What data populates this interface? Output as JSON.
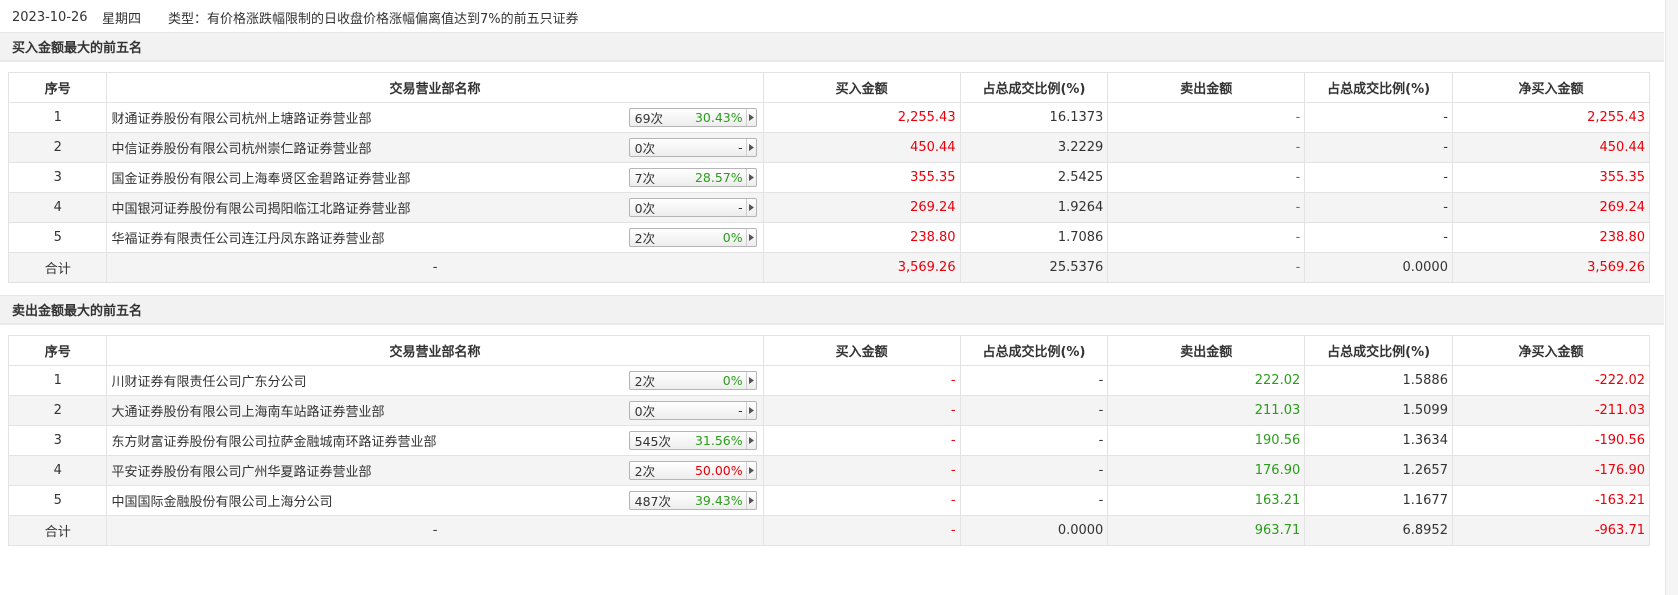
{
  "header": {
    "date": "2023-10-26",
    "weekday": "星期四",
    "type_text": "类型：有价格涨跌幅限制的日收盘价格涨幅偏离值达到7%的前五只证券"
  },
  "columns": [
    "序号",
    "交易营业部名称",
    "买入金额",
    "占总成交比例(%)",
    "卖出金额",
    "占总成交比例(%)",
    "净买入金额"
  ],
  "buy_section": {
    "title": "买入金额最大的前五名",
    "rows": [
      {
        "no": "1",
        "name": "财通证券股份有限公司杭州上塘路证券营业部",
        "count": "69次",
        "rate": "30.43%",
        "rate_color": "green",
        "buy": "2,255.43",
        "buy_pct": "16.1373",
        "sell": "-",
        "sell_pct": "-",
        "net": "2,255.43"
      },
      {
        "no": "2",
        "name": "中信证券股份有限公司杭州崇仁路证券营业部",
        "count": "0次",
        "rate": "-",
        "rate_color": "dash",
        "buy": "450.44",
        "buy_pct": "3.2229",
        "sell": "-",
        "sell_pct": "-",
        "net": "450.44"
      },
      {
        "no": "3",
        "name": "国金证券股份有限公司上海奉贤区金碧路证券营业部",
        "count": "7次",
        "rate": "28.57%",
        "rate_color": "green",
        "buy": "355.35",
        "buy_pct": "2.5425",
        "sell": "-",
        "sell_pct": "-",
        "net": "355.35"
      },
      {
        "no": "4",
        "name": "中国银河证券股份有限公司揭阳临江北路证券营业部",
        "count": "0次",
        "rate": "-",
        "rate_color": "dash",
        "buy": "269.24",
        "buy_pct": "1.9264",
        "sell": "-",
        "sell_pct": "-",
        "net": "269.24"
      },
      {
        "no": "5",
        "name": "华福证券有限责任公司连江丹凤东路证券营业部",
        "count": "2次",
        "rate": "0%",
        "rate_color": "green",
        "buy": "238.80",
        "buy_pct": "1.7086",
        "sell": "-",
        "sell_pct": "-",
        "net": "238.80"
      }
    ],
    "total": {
      "label": "合计",
      "name": "-",
      "buy": "3,569.26",
      "buy_pct": "25.5376",
      "sell": "-",
      "sell_pct": "0.0000",
      "net": "3,569.26"
    }
  },
  "sell_section": {
    "title": "卖出金额最大的前五名",
    "rows": [
      {
        "no": "1",
        "name": "川财证券有限责任公司广东分公司",
        "count": "2次",
        "rate": "0%",
        "rate_color": "green",
        "buy": "-",
        "buy_pct": "-",
        "sell": "222.02",
        "sell_pct": "1.5886",
        "net": "-222.02"
      },
      {
        "no": "2",
        "name": "大通证券股份有限公司上海南车站路证券营业部",
        "count": "0次",
        "rate": "-",
        "rate_color": "dash",
        "buy": "-",
        "buy_pct": "-",
        "sell": "211.03",
        "sell_pct": "1.5099",
        "net": "-211.03"
      },
      {
        "no": "3",
        "name": "东方财富证券股份有限公司拉萨金融城南环路证券营业部",
        "count": "545次",
        "rate": "31.56%",
        "rate_color": "green",
        "buy": "-",
        "buy_pct": "-",
        "sell": "190.56",
        "sell_pct": "1.3634",
        "net": "-190.56"
      },
      {
        "no": "4",
        "name": "平安证券股份有限公司广州华夏路证券营业部",
        "count": "2次",
        "rate": "50.00%",
        "rate_color": "red",
        "buy": "-",
        "buy_pct": "-",
        "sell": "176.90",
        "sell_pct": "1.2657",
        "net": "-176.90"
      },
      {
        "no": "5",
        "name": "中国国际金融股份有限公司上海分公司",
        "count": "487次",
        "rate": "39.43%",
        "rate_color": "green",
        "buy": "-",
        "buy_pct": "-",
        "sell": "163.21",
        "sell_pct": "1.1677",
        "net": "-163.21"
      }
    ],
    "total": {
      "label": "合计",
      "name": "-",
      "buy": "-",
      "buy_pct": "0.0000",
      "sell": "963.71",
      "sell_pct": "6.8952",
      "net": "-963.71"
    }
  },
  "colors": {
    "up": "#e8000b",
    "down": "#2a9d1a",
    "section_bg": "#f2f2f2",
    "row_alt_bg": "#f4f4f4"
  },
  "icons": {
    "badge_arrow": "caret-right-icon"
  }
}
